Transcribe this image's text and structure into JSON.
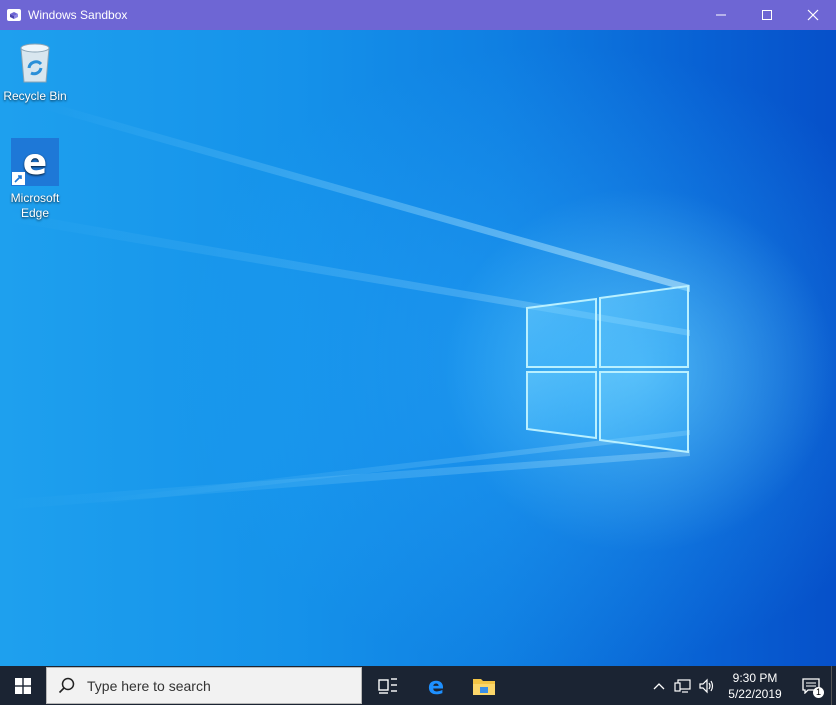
{
  "window": {
    "title": "Windows Sandbox",
    "controls": {
      "minimize": "—",
      "maximize": "☐",
      "close": "✕"
    }
  },
  "desktop": {
    "icons": [
      {
        "name": "recycle-bin",
        "label": "Recycle Bin"
      },
      {
        "name": "microsoft-edge",
        "label_line1": "Microsoft",
        "label_line2": "Edge"
      }
    ]
  },
  "taskbar": {
    "search_placeholder": "Type here to search",
    "pinned": [
      "task-view-icon",
      "edge-icon",
      "file-explorer-icon"
    ],
    "tray": {
      "icons": [
        "chevron-up-icon",
        "network-icon",
        "volume-icon"
      ],
      "time": "9:30 PM",
      "date": "5/22/2019",
      "notification_count": "1"
    }
  },
  "colors": {
    "titlebar": "#6e66d4",
    "taskbar": "#1b2433",
    "desktop_accent": "#0f7fe2"
  }
}
